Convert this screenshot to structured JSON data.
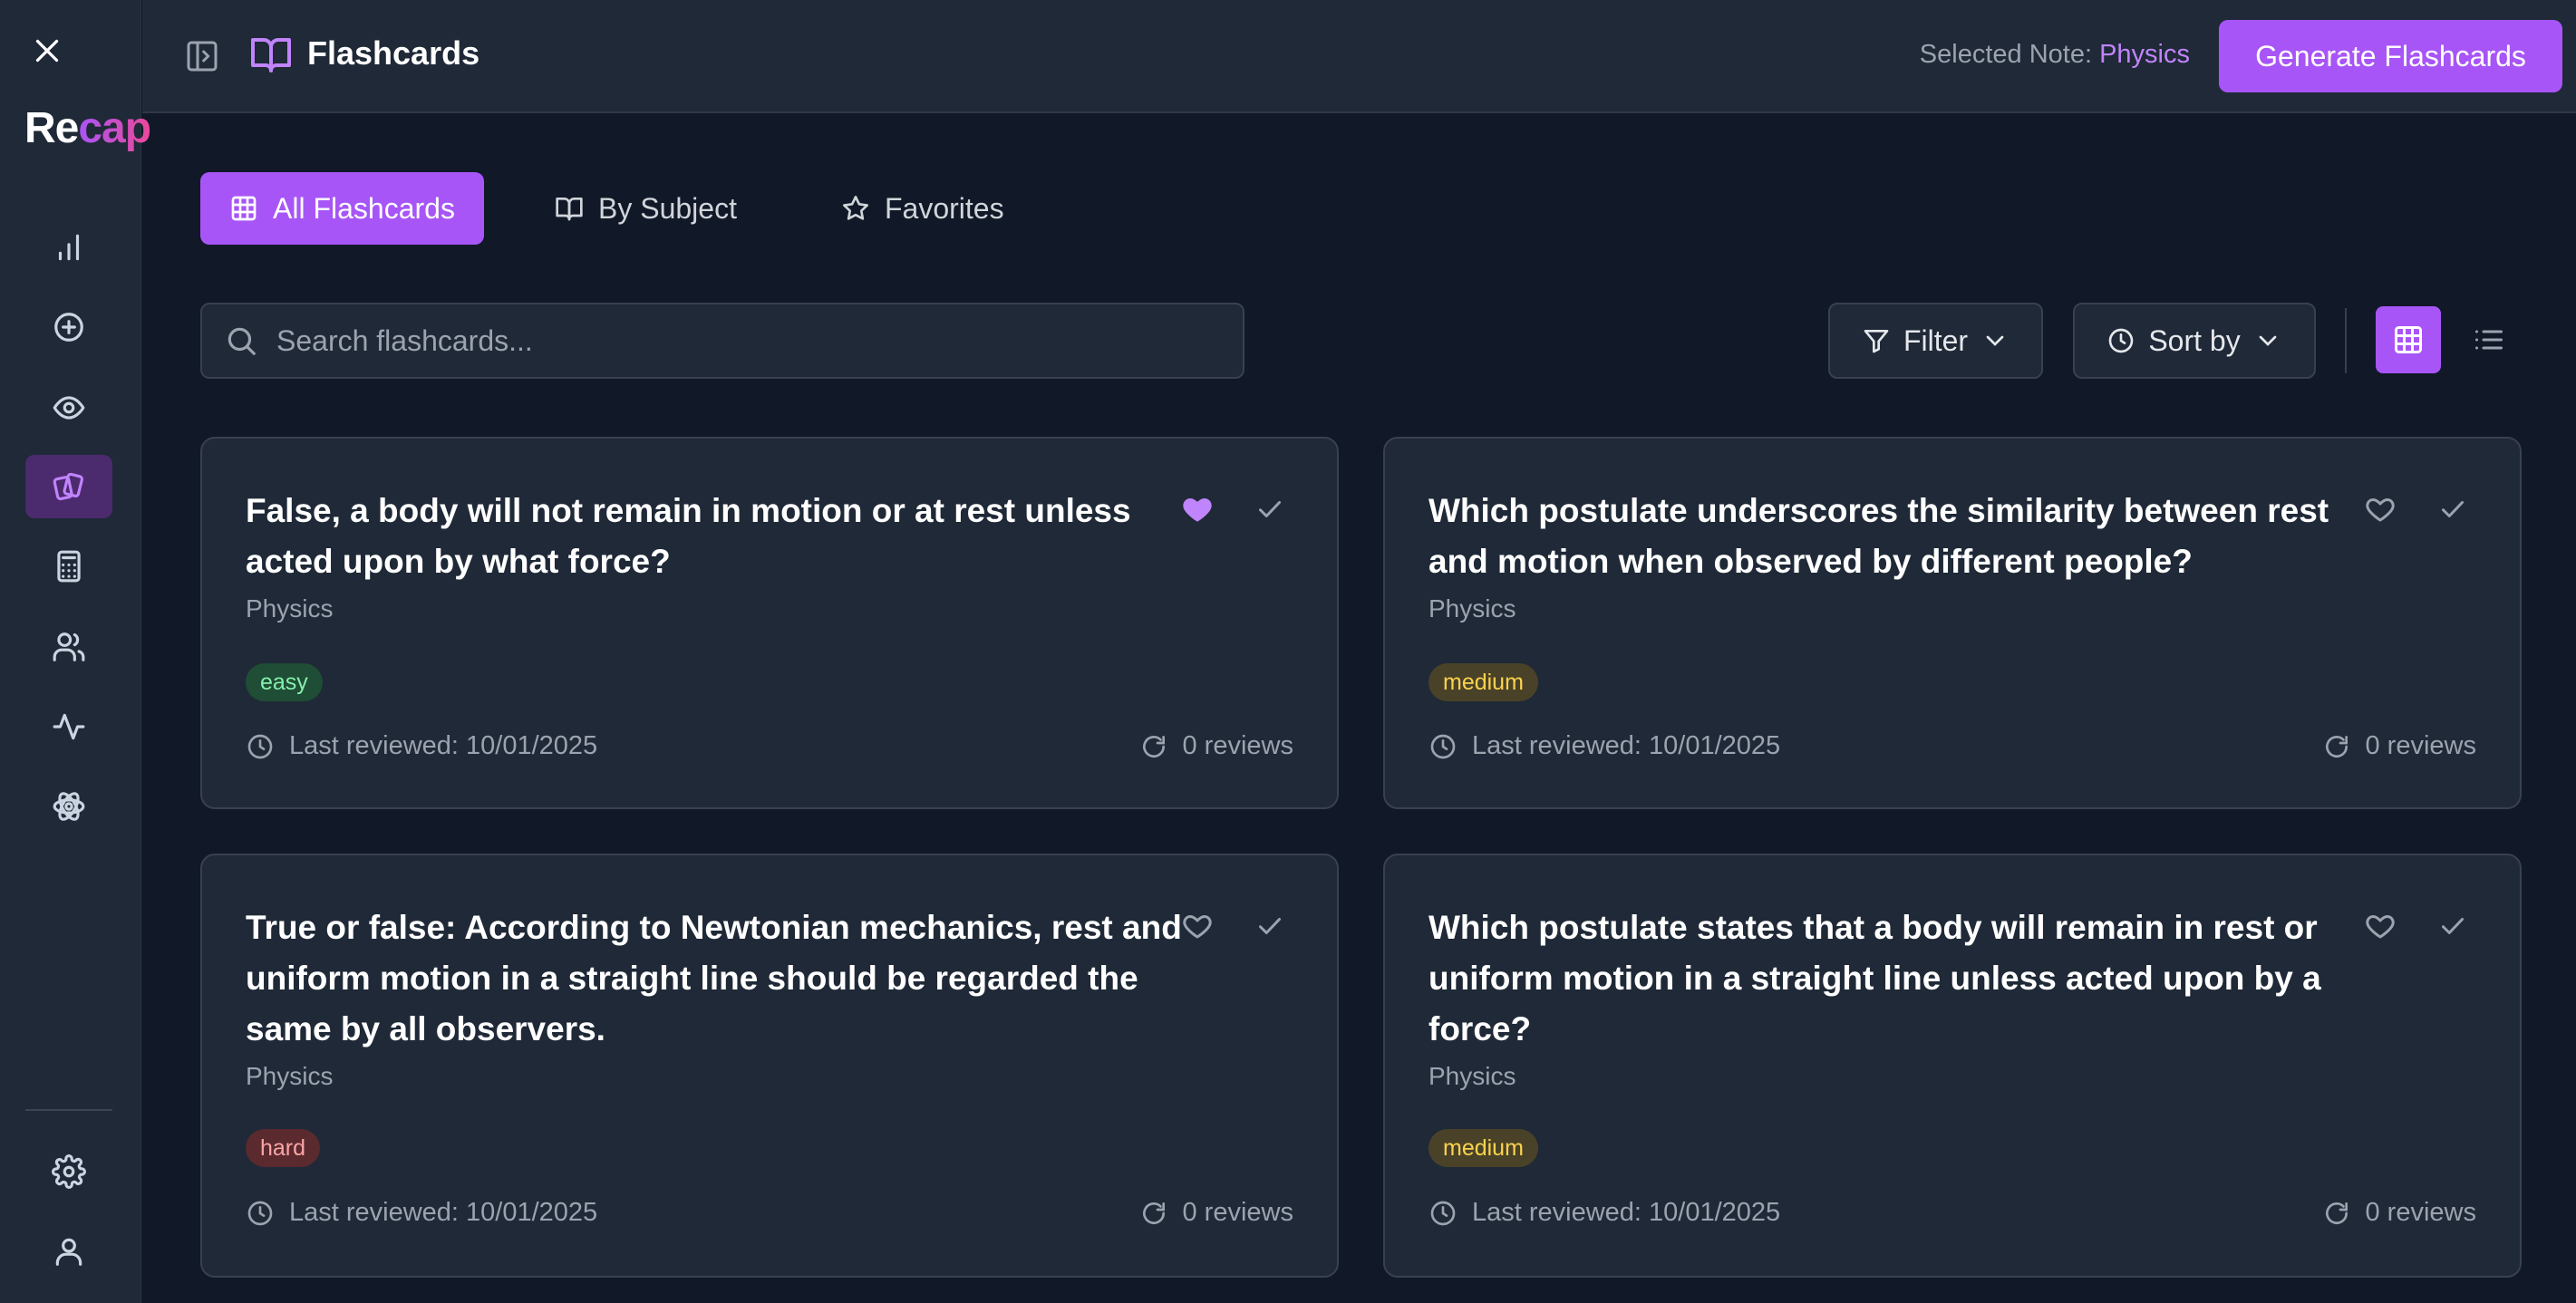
{
  "app": {
    "brand_re": "Re",
    "brand_cap": "cap"
  },
  "header": {
    "title": "Flashcards",
    "selected_note_label": "Selected Note:",
    "selected_note_value": "Physics",
    "generate_label": "Generate Flashcards"
  },
  "tabs": [
    {
      "label": "All Flashcards",
      "icon": "grid-icon",
      "active": true
    },
    {
      "label": "By Subject",
      "icon": "book-open-icon",
      "active": false
    },
    {
      "label": "Favorites",
      "icon": "star-icon",
      "active": false
    }
  ],
  "search": {
    "placeholder": "Search flashcards..."
  },
  "controls": {
    "filter_label": "Filter",
    "sort_label": "Sort by"
  },
  "sidebar": {
    "items": [
      {
        "name": "chart-icon"
      },
      {
        "name": "plus-circle-icon"
      },
      {
        "name": "eye-icon"
      },
      {
        "name": "flashcards-icon",
        "active": true
      },
      {
        "name": "calculator-icon"
      },
      {
        "name": "users-icon"
      },
      {
        "name": "activity-icon"
      },
      {
        "name": "atom-icon"
      }
    ],
    "bottom": [
      {
        "name": "settings-icon"
      },
      {
        "name": "user-icon"
      }
    ]
  },
  "cards": [
    {
      "question": "False, a body will not remain in motion or at rest unless acted upon by what force?",
      "subject": "Physics",
      "difficulty": "easy",
      "favorite": true,
      "last_reviewed": "Last reviewed: 10/01/2025",
      "reviews": "0 reviews"
    },
    {
      "question": "Which postulate underscores the similarity between rest and motion when observed by different people?",
      "subject": "Physics",
      "difficulty": "medium",
      "favorite": false,
      "last_reviewed": "Last reviewed: 10/01/2025",
      "reviews": "0 reviews"
    },
    {
      "question": "True or false: According to Newtonian mechanics, rest and uniform motion in a straight line should be regarded the same by all observers.",
      "subject": "Physics",
      "difficulty": "hard",
      "favorite": false,
      "last_reviewed": "Last reviewed: 10/01/2025",
      "reviews": "0 reviews"
    },
    {
      "question": "Which postulate states that a body will remain in rest or uniform motion in a straight line unless acted upon by a force?",
      "subject": "Physics",
      "difficulty": "medium",
      "favorite": false,
      "last_reviewed": "Last reviewed: 10/01/2025",
      "reviews": "0 reviews"
    }
  ],
  "colors": {
    "accent": "#a855f7",
    "background": "#111827",
    "surface": "#1f2937",
    "muted_text": "#9ca3af"
  }
}
